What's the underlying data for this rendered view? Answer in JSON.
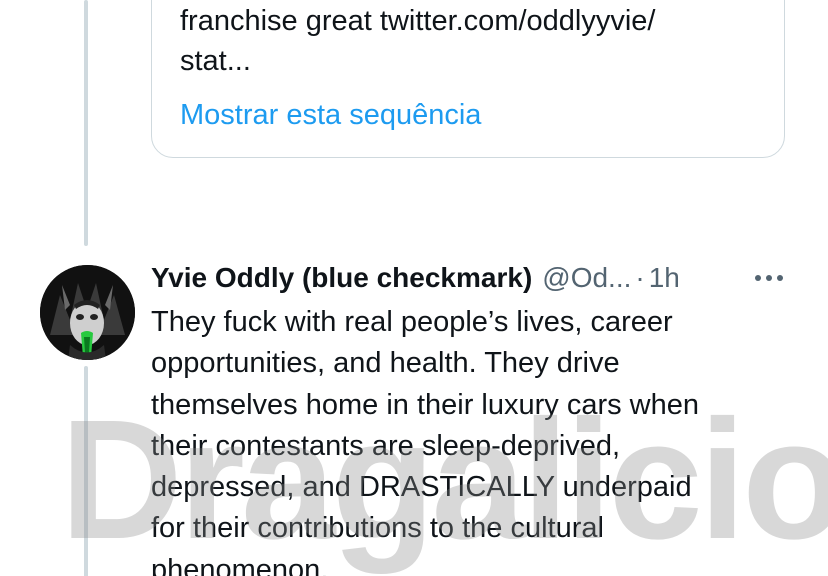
{
  "quoted_tweet": {
    "text_lines": [
      "franchise great twitter.com/oddlyyvie/",
      "stat..."
    ],
    "show_thread_label": "Mostrar esta sequência"
  },
  "tweet": {
    "author_name": "Yvie Oddly (blue checkmark)",
    "author_handle": "@Od...",
    "separator": "·",
    "timestamp": "1h",
    "more_icon": "more-horizontal-icon",
    "body_lines": [
      "They fuck with real people’s lives, career",
      "opportunities, and health. They drive",
      "themselves home in their luxury cars when",
      "their contestants are sleep-deprived,",
      "depressed, and DRASTICALLY underpaid",
      "for their contributions to the cultural",
      "phenomenon."
    ]
  },
  "watermark": {
    "text": "Dragalicious"
  },
  "colors": {
    "link": "#1d9bf0",
    "secondary_text": "#536471",
    "border": "#cfd9de"
  }
}
